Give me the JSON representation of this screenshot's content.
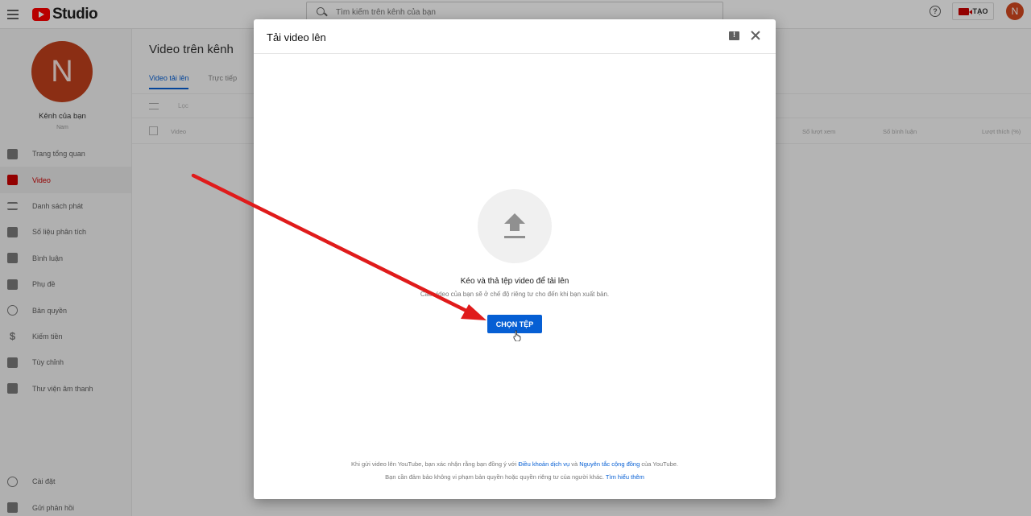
{
  "topbar": {
    "logo_text": "Studio",
    "search_placeholder": "Tìm kiếm trên kênh của bạn",
    "help_glyph": "?",
    "create_label": "TẠO",
    "avatar_letter": "N"
  },
  "sidebar": {
    "avatar_letter": "N",
    "channel_name": "Kênh của bạn",
    "channel_handle": "Nam",
    "items": [
      {
        "label": "Trang tổng quan",
        "icon": "dashboard-icon"
      },
      {
        "label": "Video",
        "icon": "video-icon",
        "active": true
      },
      {
        "label": "Danh sách phát",
        "icon": "playlist-icon"
      },
      {
        "label": "Số liệu phân tích",
        "icon": "analytics-icon"
      },
      {
        "label": "Bình luận",
        "icon": "comments-icon"
      },
      {
        "label": "Phụ đề",
        "icon": "subtitles-icon"
      },
      {
        "label": "Bản quyền",
        "icon": "copyright-icon"
      },
      {
        "label": "Kiếm tiền",
        "icon": "dollar-icon"
      },
      {
        "label": "Tùy chỉnh",
        "icon": "magic-wand-icon"
      },
      {
        "label": "Thư viện âm thanh",
        "icon": "audio-library-icon"
      }
    ],
    "bottom_items": [
      {
        "label": "Cài đặt",
        "icon": "gear-icon"
      },
      {
        "label": "Gửi phản hồi",
        "icon": "feedback-icon"
      }
    ]
  },
  "main": {
    "title": "Video trên kênh",
    "tabs": [
      {
        "label": "Video tải lên",
        "active": true
      },
      {
        "label": "Trực tiếp",
        "active": false
      }
    ],
    "filter_text": "Lọc",
    "columns": [
      "Video",
      "Số lượt xem",
      "Số bình luận",
      "Lượt thích (%)"
    ]
  },
  "dialog": {
    "title": "Tải video lên",
    "drop_title": "Kéo và thả tệp video để tải lên",
    "drop_subtitle": "Các video của bạn sẽ ở chế độ riêng tư cho đến khi bạn xuất bản.",
    "select_button": "CHỌN TỆP",
    "footer_line1_prefix": "Khi gửi video lên YouTube, bạn xác nhận rằng bạn đồng ý với ",
    "footer_link_terms": "Điều khoản dịch vụ",
    "footer_line1_mid": " và ",
    "footer_link_guidelines": "Nguyên tắc cộng đồng",
    "footer_line1_suffix": " của YouTube.",
    "footer_line2_prefix": "Bạn cần đảm bảo không vi phạm bản quyền hoặc quyền riêng tư của người khác. ",
    "footer_link_learn": "Tìm hiểu thêm"
  },
  "colors": {
    "brand": "#ff0000",
    "accent": "#065fd4",
    "annotation_arrow": "#e01b1b",
    "avatar": "#c1401c"
  }
}
